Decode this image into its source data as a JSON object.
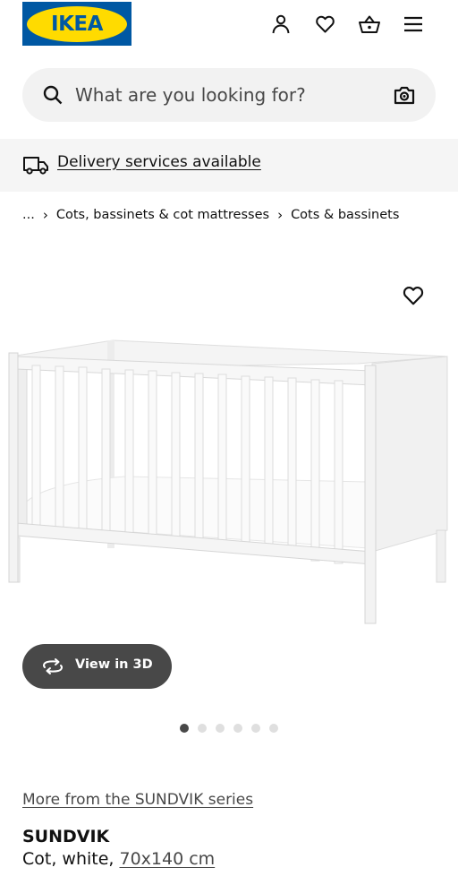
{
  "header": {
    "logo_text": "IKEA",
    "icons": [
      "person-icon",
      "heart-icon",
      "basket-icon",
      "menu-icon"
    ]
  },
  "search": {
    "placeholder": "What are you looking for?",
    "value": ""
  },
  "delivery": {
    "label": "Delivery services available"
  },
  "breadcrumb": {
    "ellipsis": "...",
    "items": [
      "Cots, bassinets & cot mattresses",
      "Cots & bassinets"
    ],
    "separator": "›"
  },
  "gallery": {
    "view3d_label": "View in 3D",
    "slide_count": 6,
    "active_slide": 1
  },
  "product": {
    "series_link": "More from the SUNDVIK series",
    "name": "SUNDVIK",
    "description": "Cot, white, ",
    "size": "70x140 cm"
  },
  "colors": {
    "brand_blue": "#0058a3",
    "brand_yellow": "#ffdb00",
    "dark_grey": "#484848",
    "light_grey": "#f2f2f2"
  }
}
